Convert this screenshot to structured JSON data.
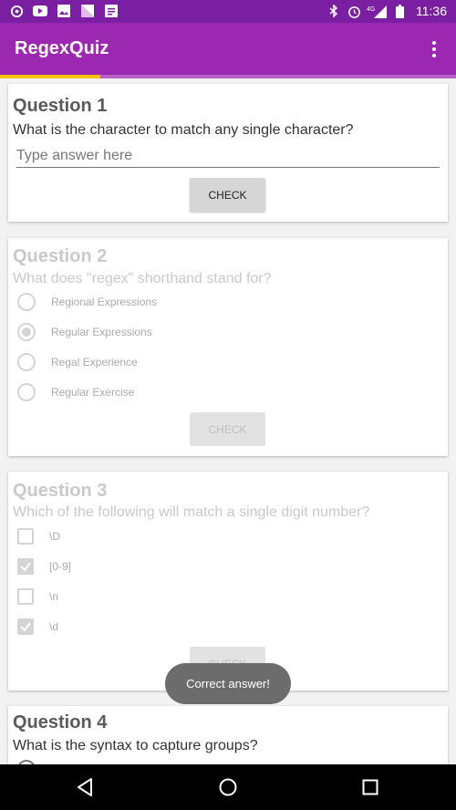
{
  "status_bar": {
    "time": "11:36",
    "network": "4G",
    "icons_left": [
      "sync-icon",
      "youtube-icon",
      "image-icon",
      "news-icon",
      "message-icon"
    ],
    "icons_right": [
      "bluetooth-icon",
      "alarm-icon",
      "signal-icon",
      "battery-icon"
    ]
  },
  "app_bar": {
    "title": "RegexQuiz",
    "menu_icon": "more-vert-icon",
    "color": "#9c27b0"
  },
  "progress": {
    "fraction": 0.22,
    "color": "#ffc107"
  },
  "questions": [
    {
      "title": "Question 1",
      "text": "What is the character to match any single character?",
      "input_placeholder": "Type answer here",
      "input_value": "",
      "button": "CHECK"
    },
    {
      "title": "Question 2",
      "text": "What does \"regex\" shorthand stand for?",
      "options": [
        "Regional Expressions",
        "Regular Expressions",
        "Regal Experience",
        "Regular Exercise"
      ],
      "selected": 1,
      "button": "CHECK"
    },
    {
      "title": "Question 3",
      "text": "Which of the following will match a single digit number?",
      "options": [
        "\\D",
        "[0-9]",
        "\\n",
        "\\d"
      ],
      "checked": [
        false,
        true,
        false,
        true
      ],
      "button": "CHECK"
    },
    {
      "title": "Question 4",
      "text": "What is the syntax to capture groups?"
    }
  ],
  "toast": "Correct answer!",
  "nav": {
    "back": "back-icon",
    "home": "home-icon",
    "recents": "recents-icon"
  }
}
